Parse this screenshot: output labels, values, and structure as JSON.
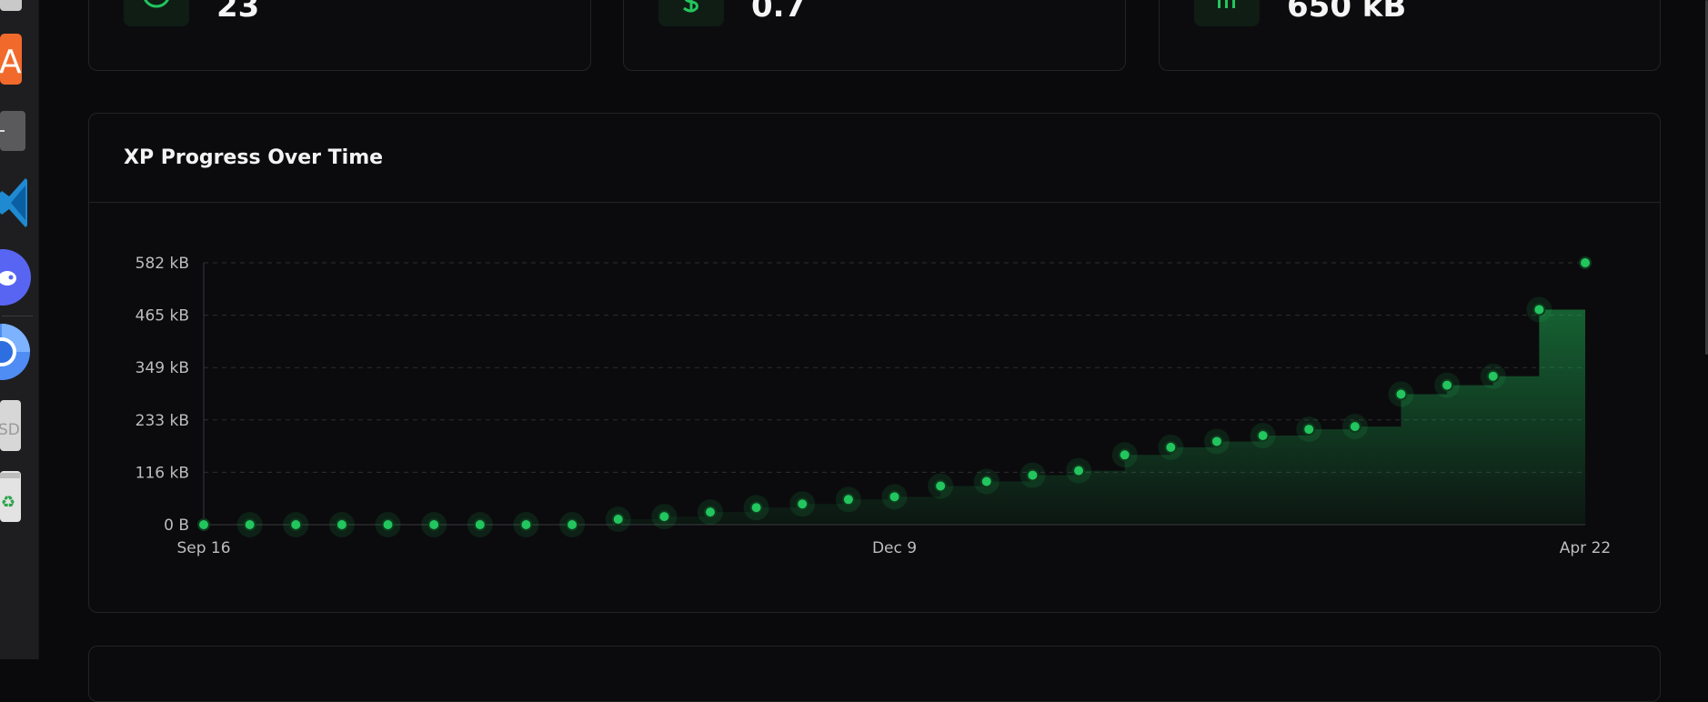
{
  "stats": [
    {
      "icon": "circle-icon",
      "value": "23"
    },
    {
      "icon": "dollar-icon",
      "value": "0.7"
    },
    {
      "icon": "bars-icon",
      "value": "650 kB"
    }
  ],
  "dock": {
    "items": [
      "app-store-icon",
      "terminal-icon",
      "vscode-icon",
      "discord-icon",
      "chrome-icon",
      "sd-card-icon",
      "trash-icon"
    ]
  },
  "chart_title": "XP Progress Over Time",
  "accent": "#22c55e",
  "chart_data": {
    "type": "area",
    "step": true,
    "x_ticks": [
      "Sep 16",
      "Dec 9",
      "Apr 22"
    ],
    "y_ticks": [
      "0 B",
      "116 kB",
      "233 kB",
      "349 kB",
      "465 kB",
      "582 kB"
    ],
    "ylim": [
      0,
      582
    ],
    "y_unit": "kB",
    "grid": true,
    "values": [
      0,
      0,
      0,
      0,
      0,
      0,
      0,
      0,
      0,
      12,
      18,
      28,
      38,
      46,
      56,
      62,
      86,
      96,
      110,
      120,
      155,
      172,
      185,
      198,
      212,
      218,
      290,
      310,
      330,
      478,
      582
    ]
  }
}
